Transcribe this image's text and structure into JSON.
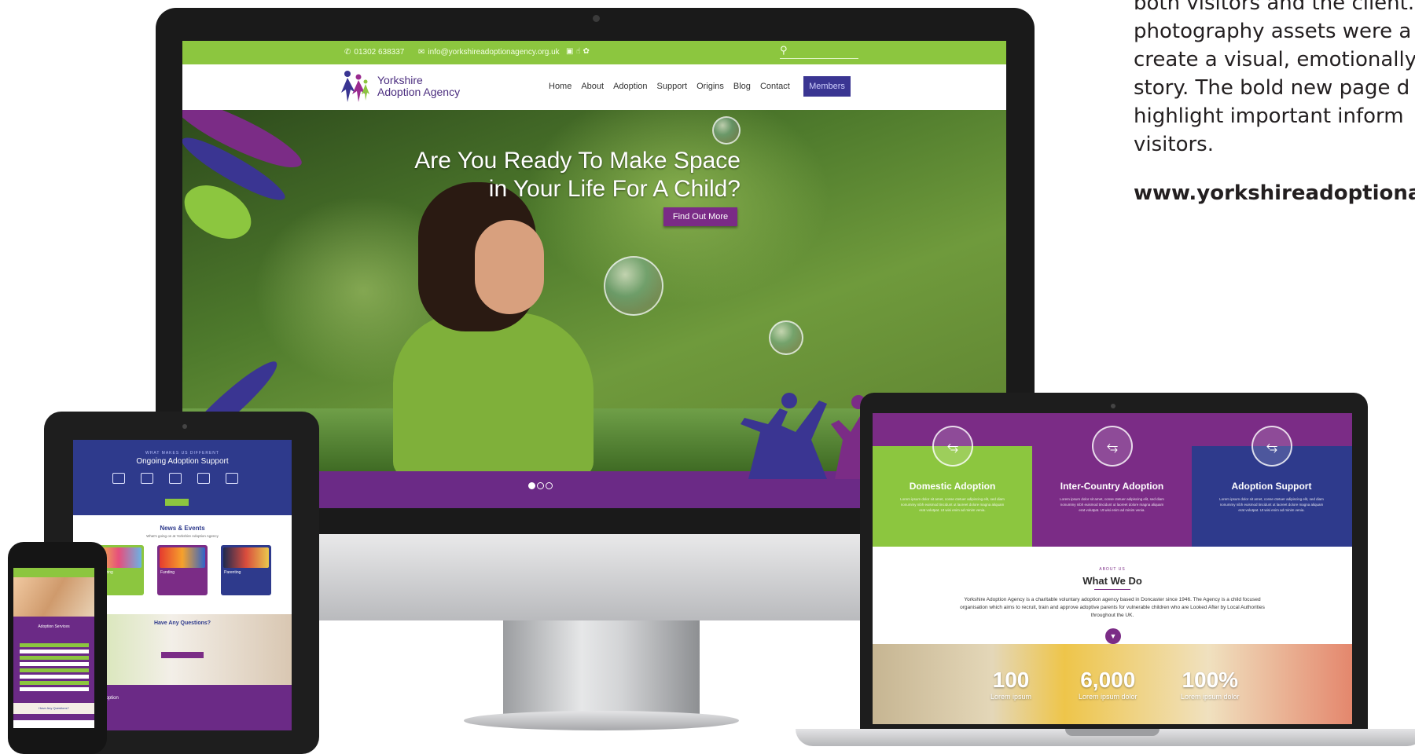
{
  "side_text": {
    "lines": [
      "both visitors and the client.",
      "photography assets were a",
      "create a visual, emotionally",
      "story. The bold new page d",
      "highlight important inform",
      "visitors."
    ],
    "url": "www.yorkshireadoptionag"
  },
  "desktop": {
    "topbar": {
      "phone": "01302 638337",
      "email": "info@yorkshireadoptionagency.org.uk",
      "social_icons": [
        "facebook-icon",
        "like-icon",
        "twitter-icon"
      ]
    },
    "logo": {
      "line1": "Yorkshire",
      "line2": "Adoption Agency"
    },
    "nav": [
      "Home",
      "About",
      "Adoption",
      "Support",
      "Origins",
      "Blog",
      "Contact"
    ],
    "members_label": "Members",
    "hero": {
      "title_line1": "Are You Ready To Make Space",
      "title_line2": "in Your Life For A Child?",
      "cta": "Find Out More",
      "slide_count": 3,
      "active_slide": 1
    }
  },
  "tablet": {
    "kicker": "WHAT MAKES US DIFFERENT",
    "heading": "Ongoing Adoption Support",
    "news_heading": "News & Events",
    "news_sub": "What's going on at Yorkshire Adoption Agency",
    "cards": [
      "Fostering",
      "Funding",
      "Parenting"
    ],
    "questions_heading": "Have Any Questions?",
    "footer_logo": "Yorkshire Adoption Agency"
  },
  "phone": {
    "section_title": "Adoption Services",
    "questions": "Have Any Questions?"
  },
  "laptop": {
    "panels": [
      {
        "title": "Domestic Adoption",
        "color": "#8cc63f",
        "text": "Lorem ipsum dolor sit amet, conse ctetuer adipiscing elit, sed diam nonummy nibh euismod tincidunt ut laoreet dolore magna aliquam erat volutpat. Ut wisi enim ad minim venia."
      },
      {
        "title": "Inter-Country Adoption",
        "color": "#7b2c86",
        "text": "Lorem ipsum dolor sit amet, conse ctetuer adipiscing elit, sed diam nonummy nibh euismod tincidunt ut laoreet dolore magna aliquam erat volutpat. Ut wisi enim ad minim venia."
      },
      {
        "title": "Adoption Support",
        "color": "#2e3a8c",
        "text": "Lorem ipsum dolor sit amet, conse ctetuer adipiscing elit, sed diam nonummy nibh euismod tincidunt ut laoreet dolore magna aliquam erat volutpat. Ut wisi enim ad minim venia."
      }
    ],
    "about_kicker": "ABOUT US",
    "about_title": "What We Do",
    "about_body": "Yorkshire Adoption Agency is a charitable voluntary adoption agency based in Doncaster since 1946. The Agency is a child focused organisation which aims to recruit, train and approve adoptive parents for vulnerable children who are Looked After by Local Authorities throughout the UK.",
    "stats": [
      {
        "value": "100",
        "label": "Lorem ipsum"
      },
      {
        "value": "6,000",
        "label": "Lorem ipsum dolor"
      },
      {
        "value": "100%",
        "label": "Lorem ipsum dolor"
      }
    ]
  },
  "colors": {
    "green": "#8cc63f",
    "purple": "#7b2c86",
    "navy": "#2e3a8c"
  }
}
